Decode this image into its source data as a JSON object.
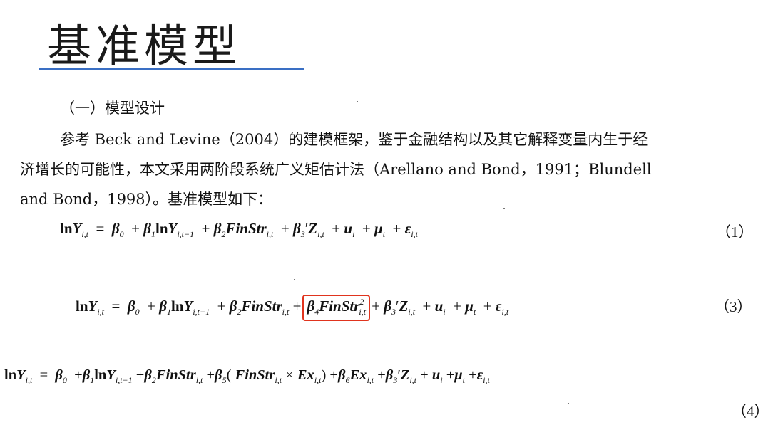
{
  "title": "基准模型",
  "section_heading": "（一）模型设计",
  "paragraph": {
    "line1": "参考 Beck and Levine（2004）的建模框架，鉴于金融结构以及其它解释变量内生于经",
    "line2": "济增长的可能性，本文采用两阶段系统广义矩估计法（Arellano and Bond，1991；Blundell",
    "line3": "and Bond，1998）。基准模型如下："
  },
  "equations": {
    "eq1_number": "（1）",
    "eq3_number": "（3）",
    "eq4_number": "（4）"
  },
  "highlight_color": "#e0341e",
  "rule_color": "#3a6fc4"
}
